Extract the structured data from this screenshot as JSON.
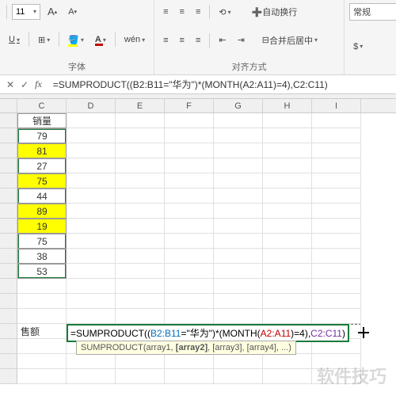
{
  "ribbon": {
    "font_size": "11",
    "grow_font": "A",
    "shrink_font": "A",
    "underline": "U",
    "wen": "wén",
    "wrap_text": "自动换行",
    "merge_center": "合并后居中",
    "font_group_label": "字体",
    "align_group_label": "对齐方式",
    "number_format": "常规"
  },
  "formula_bar": {
    "check": "✓",
    "fx": "fx",
    "formula_prefix": "=SUMPRODUCT((",
    "formula_b": "B2:B11",
    "formula_mid1": "=\"华为\")*(MONTH(",
    "formula_a": "A2:A11",
    "formula_mid2": ")=4),",
    "formula_c": "C2:C11",
    "formula_suffix": ")"
  },
  "columns": [
    "",
    "C",
    "D",
    "E",
    "F",
    "G",
    "H",
    "I"
  ],
  "data_header": "销量",
  "data_values": [
    {
      "v": "79",
      "hl": false
    },
    {
      "v": "81",
      "hl": true
    },
    {
      "v": "27",
      "hl": false
    },
    {
      "v": "75",
      "hl": true
    },
    {
      "v": "44",
      "hl": false
    },
    {
      "v": "89",
      "hl": true
    },
    {
      "v": "19",
      "hl": true
    },
    {
      "v": "75",
      "hl": false
    },
    {
      "v": "38",
      "hl": false
    },
    {
      "v": "53",
      "hl": false
    }
  ],
  "row_label": "售额",
  "edit_formula": {
    "p1": "=SUMPRODUCT((",
    "p2": "B2:B11",
    "p3": "=\"华为\")*(MONTH(",
    "p4": "A2:A11",
    "p5": ")=4),",
    "p6": "C2:C11",
    "p7": ")"
  },
  "tooltip": {
    "fn": "SUMPRODUCT(",
    "a1": "array1, ",
    "a2": "[array2]",
    "a3": ", [array3], [array4], ...)"
  },
  "watermark": "软件技巧"
}
